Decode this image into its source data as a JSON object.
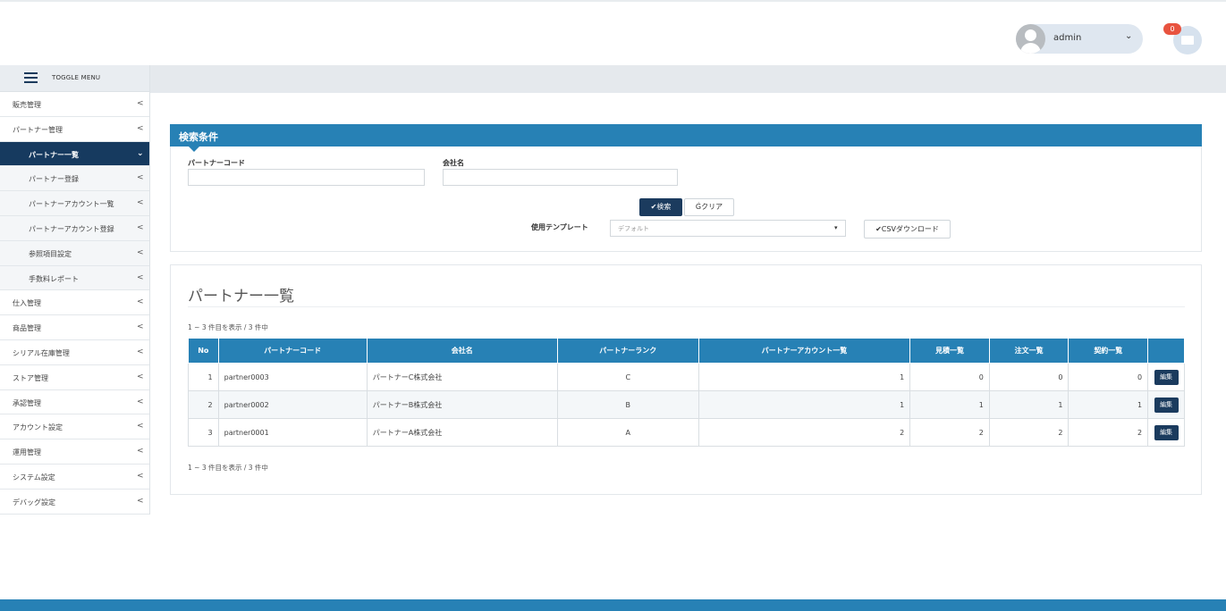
{
  "header": {
    "user_name": "admin",
    "mail_count": "0",
    "user_chevron": "⌄"
  },
  "sidebar": {
    "toggle_label": "TOGGLE MENU",
    "items": [
      {
        "label": "販売管理",
        "arrow": "<",
        "level": 0
      },
      {
        "label": "パートナー管理",
        "arrow": "<",
        "level": 0
      },
      {
        "label": "パートナー一覧",
        "arrow": "⌄",
        "level": 1,
        "active": true
      },
      {
        "label": "パートナー登録",
        "arrow": "<",
        "level": 1
      },
      {
        "label": "パートナーアカウント一覧",
        "arrow": "<",
        "level": 1
      },
      {
        "label": "パートナーアカウント登録",
        "arrow": "<",
        "level": 1
      },
      {
        "label": "参照項目設定",
        "arrow": "<",
        "level": 1
      },
      {
        "label": "手数料レポート",
        "arrow": "<",
        "level": 1
      },
      {
        "label": "仕入管理",
        "arrow": "<",
        "level": 0
      },
      {
        "label": "商品管理",
        "arrow": "<",
        "level": 0
      },
      {
        "label": "シリアル在庫管理",
        "arrow": "<",
        "level": 0
      },
      {
        "label": "ストア管理",
        "arrow": "<",
        "level": 0
      },
      {
        "label": "承認管理",
        "arrow": "<",
        "level": 0
      },
      {
        "label": "アカウント設定",
        "arrow": "<",
        "level": 0
      },
      {
        "label": "運用管理",
        "arrow": "<",
        "level": 0
      },
      {
        "label": "システム設定",
        "arrow": "<",
        "level": 0
      },
      {
        "label": "デバッグ設定",
        "arrow": "<",
        "level": 0
      }
    ]
  },
  "search": {
    "title": "検索条件",
    "partner_code_label": "パートナーコード",
    "partner_code_value": "",
    "company_label": "会社名",
    "company_value": "",
    "search_button": "✔検索",
    "clear_button": "Ġクリア",
    "template_label": "使用テンプレート",
    "template_value": "デフォルト",
    "template_caret": "▾",
    "csv_button": "✔CSVダウンロード"
  },
  "list": {
    "title": "パートナー一覧",
    "count_top": "1 ~ 3 件目を表示 / 3 件中",
    "count_bottom": "1 ~ 3 件目を表示 / 3 件中",
    "columns": [
      "No",
      "パートナーコード",
      "会社名",
      "パートナーランク",
      "パートナーアカウント一覧",
      "見積一覧",
      "注文一覧",
      "契約一覧",
      ""
    ],
    "rows": [
      {
        "no": "1",
        "code": "partner0003",
        "company": "パートナーC株式会社",
        "rank": "C",
        "accounts": "1",
        "estimates": "0",
        "orders": "0",
        "contracts": "0",
        "edit": "編集"
      },
      {
        "no": "2",
        "code": "partner0002",
        "company": "パートナーB株式会社",
        "rank": "B",
        "accounts": "1",
        "estimates": "1",
        "orders": "1",
        "contracts": "1",
        "edit": "編集"
      },
      {
        "no": "3",
        "code": "partner0001",
        "company": "パートナーA株式会社",
        "rank": "A",
        "accounts": "2",
        "estimates": "2",
        "orders": "2",
        "contracts": "2",
        "edit": "編集"
      }
    ]
  },
  "colors": {
    "accent": "#2781b5",
    "nav_active": "#163a5f",
    "badge": "#e8533f"
  }
}
